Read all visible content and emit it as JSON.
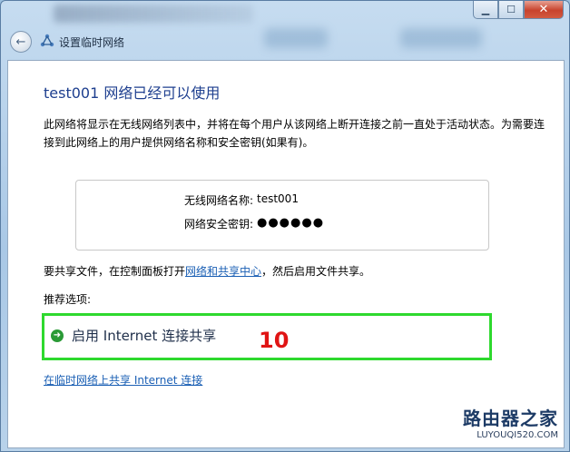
{
  "window": {
    "caption_buttons": {
      "minimize": "▁",
      "maximize": "☐",
      "close": "✕"
    },
    "back_icon": "back-arrow-icon",
    "wizard_title": "设置临时网络"
  },
  "page": {
    "heading": "test001 网络已经可以使用",
    "description": "此网络将显示在无线网络列表中，并将在每个用户从该网络上断开连接之前一直处于活动状态。为需要连接到此网络上的用户提供网络名称和安全密钥(如果有)。",
    "info": {
      "name_label": "无线网络名称:",
      "name_value": "test001",
      "key_label": "网络安全密钥:",
      "key_value": "●●●●●●"
    },
    "share_prefix": "要共享文件，在控制面板打开",
    "share_link": "网络和共享中心",
    "share_suffix": "，然后启用文件共享。",
    "recommended_label": "推荐选项:",
    "option_label": "启用 Internet 连接共享",
    "annotation": "10",
    "bottom_link": "在临时网络上共享 Internet 连接"
  },
  "watermark": {
    "cn": "路由器之家",
    "en": "LUYOUQI520.COM"
  },
  "colors": {
    "heading": "#1e3f8f",
    "link": "#1a5fb4",
    "highlight": "#2ed92e",
    "annotation": "#e01414"
  }
}
